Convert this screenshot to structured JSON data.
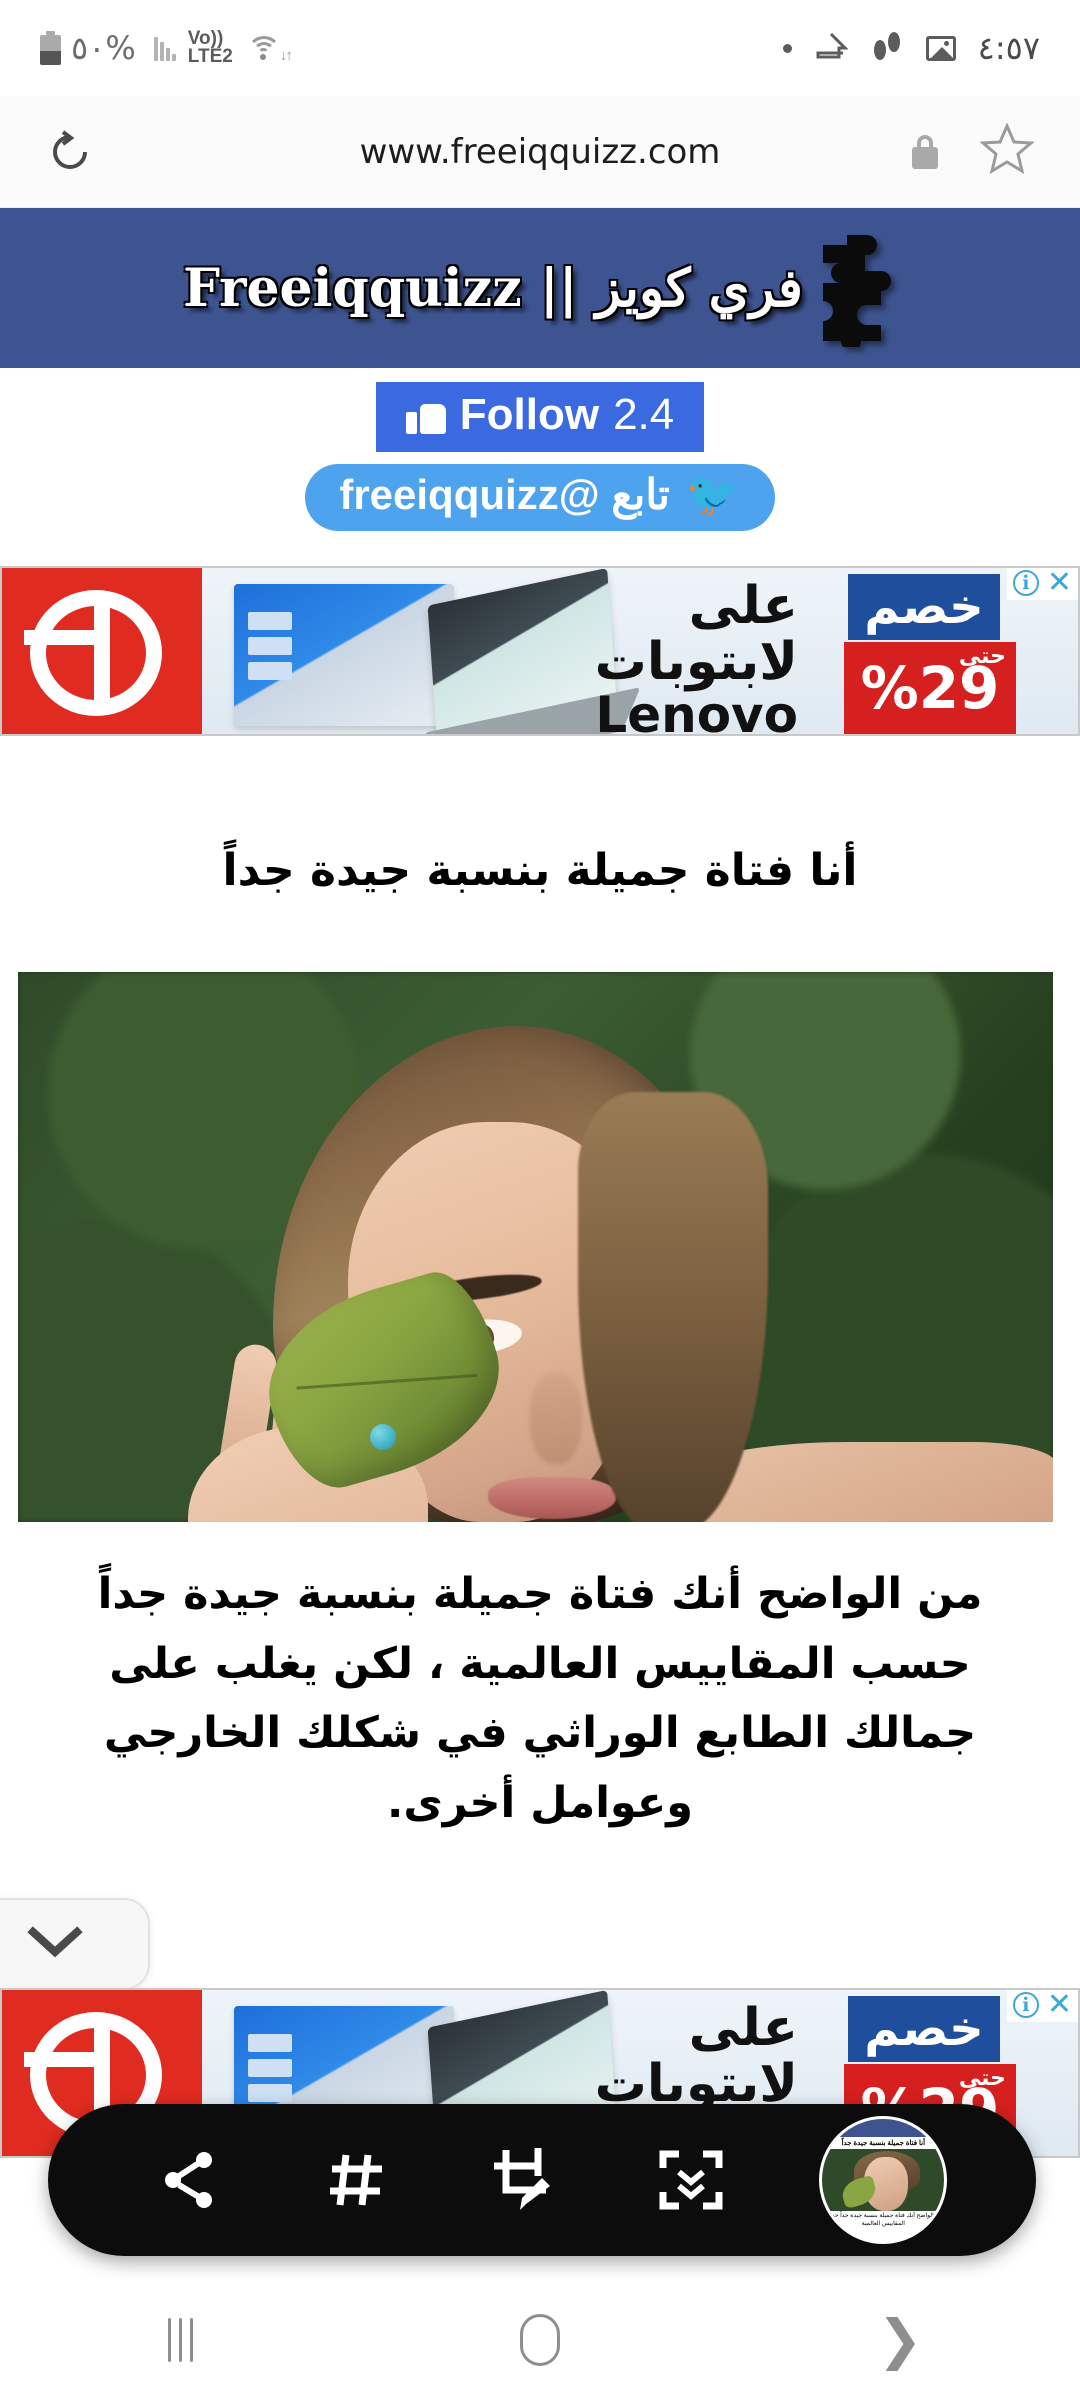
{
  "status_bar": {
    "battery_percent": "٥٠%",
    "network_label": "Vo))",
    "network_type": "LTE2",
    "time": "٤:٥٧",
    "icons": [
      "battery-icon",
      "signal-bars-icon",
      "volte-icon",
      "wifi-icon",
      "dot-icon",
      "home-shape-icon",
      "footsteps-icon",
      "gallery-icon"
    ]
  },
  "browser": {
    "url": "www.freeiqquizz.com",
    "reload_icon": "reload-icon",
    "lock_icon": "lock-icon",
    "bookmark_icon": "star-icon"
  },
  "site_header": {
    "logo_text": "فري كويز || Freeiqquizz",
    "background_color": "#3d5490",
    "logo_icon": "puzzle-piece-icon"
  },
  "social": {
    "facebook": {
      "label": "Follow",
      "count": "2.4",
      "icon": "thumbs-up-icon",
      "color": "#3b6ae0"
    },
    "twitter": {
      "label": "تابع @freeiqquizz",
      "icon": "twitter-bird-icon",
      "color": "#4ea3ef"
    }
  },
  "ad": {
    "brand_logo": "advertiser-logo-icon",
    "line1": "على",
    "line2": "لابتوبات",
    "line3": "Lenovo",
    "badge_label": "خصم",
    "badge_prefix": "حتى",
    "badge_value": "%29",
    "info_icon": "ad-info-icon",
    "close_icon": "ad-close-icon",
    "close_label": "✕",
    "info_label": "i"
  },
  "article": {
    "title": "أنا فتاة جميلة بنسبة جيدة جداً",
    "photo_alt": "woman-holding-leaf-photo",
    "body": "من الواضح أنك فتاة جميلة بنسبة جيدة جداً حسب المقاييس العالمية ، لكن يغلب على جمالك الطابع الوراثي في شكلك الخارجي وعوامل أخرى."
  },
  "collapse_tab": {
    "icon": "chevron-down-icon"
  },
  "screenshot_toolbar": {
    "items": [
      {
        "name": "share-icon"
      },
      {
        "name": "hashtag-tag-icon"
      },
      {
        "name": "crop-edit-icon"
      },
      {
        "name": "scroll-capture-icon"
      },
      {
        "name": "screenshot-thumbnail"
      }
    ],
    "thumbnail": {
      "title": "أنا فتاة جميلة بنسبة جيدة جداً",
      "caption": "من الواضح أنك فتاة جميلة بنسبة جيدة جداً حسب المقاييس العالمية"
    }
  },
  "nav_bar": {
    "recents_label": "recents-icon",
    "home_label": "home-icon",
    "back_label": "❯"
  }
}
